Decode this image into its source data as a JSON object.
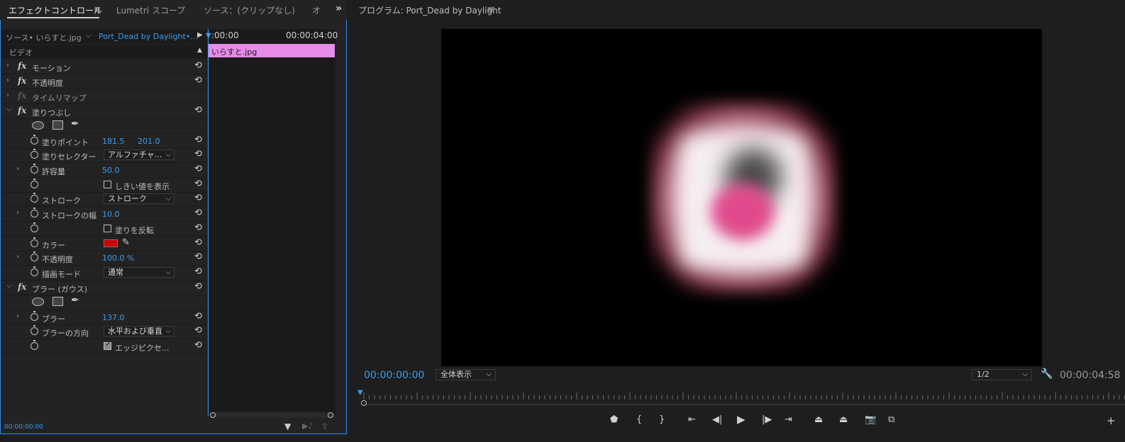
{
  "tabs": [
    {
      "label": "エフェクトコントロール",
      "active": true
    },
    {
      "label": "Lumetri スコープ",
      "active": false
    },
    {
      "label": "ソース：(クリップなし)",
      "active": false
    },
    {
      "label": "オ",
      "active": false
    }
  ],
  "panel_menu_icon": "hamburger-icon",
  "overflow_icon": "double-chevron-right-icon",
  "source": {
    "clip_label": "ソース• いらすと.jpg",
    "sequence_label": "Port_Dead by Daylight•..."
  },
  "mini_timeline": {
    "start_tc": ":00:00",
    "end_tc": "00:00:04:00",
    "clip_name": "いらすと.jpg"
  },
  "video_header": "ビデオ",
  "effects": {
    "motion": "モーション",
    "opacity": "不透明度",
    "time_remap": "タイムリマップ",
    "fill": {
      "name": "塗りつぶし",
      "fill_point_label": "塗りポイント",
      "fill_point_x": "181.5",
      "fill_point_y": "201.0",
      "fill_selector_label": "塗りセレクター",
      "fill_selector_value": "アルファチャ...",
      "tolerance_label": "許容量",
      "tolerance_value": "50.0",
      "show_threshold_label": "しきい値を表示",
      "stroke_label": "ストローク",
      "stroke_value": "ストローク",
      "stroke_width_label": "ストロークの幅",
      "stroke_width_value": "10.0",
      "invert_label": "塗りを反転",
      "color_label": "カラー",
      "color_value": "#cc0000",
      "opacity_label": "不透明度",
      "opacity_value": "100.0 %",
      "blend_mode_label": "描画モード",
      "blend_mode_value": "通常"
    },
    "gaussian_blur": {
      "name": "ブラー (ガウス)",
      "blurriness_label": "ブラー",
      "blurriness_value": "137.0",
      "direction_label": "ブラーの方向",
      "direction_value": "水平および垂直",
      "repeat_edge_label": "エッジピクセ...",
      "repeat_edge_checked": true
    }
  },
  "left_footer_tc": "00:00:00:00",
  "program": {
    "title": "プログラム: Port_Dead by Daylight",
    "current_tc": "00:00:00:00",
    "zoom_value": "全体表示",
    "resolution_value": "1/2",
    "duration_tc": "00:00:04:58"
  },
  "controls": [
    "add-marker-icon",
    "mark-in-icon",
    "mark-out-icon",
    "go-to-in-icon",
    "step-back-icon",
    "play-icon",
    "step-forward-icon",
    "go-to-out-icon",
    "lift-icon",
    "extract-icon",
    "export-frame-icon",
    "comparison-view-icon"
  ]
}
